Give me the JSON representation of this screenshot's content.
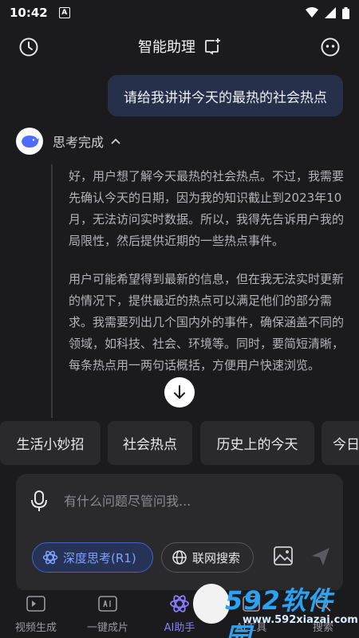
{
  "status": {
    "time": "10:42",
    "notif": "A"
  },
  "header": {
    "title": "智能助理"
  },
  "user_message": "请给我讲讲今天的最热的社会热点",
  "thinking": {
    "label": "思考完成",
    "paragraphs": [
      "好，用户想了解今天最热的社会热点。不过，我需要先确认今天的日期，因为我的知识截止到2023年10月，无法访问实时数据。所以，我得先告诉用户我的局限性，然后提供近期的一些热点事件。",
      "用户可能希望得到最新的信息，但在我无法实时更新的情况下，提供最近的热点可以满足他们的部分需求。我需要列出几个国内外的事件，确保涵盖不同的领域，如科技、社会、环境等。同时，要简短清晰，每条热点用一两句话概括，方便用户快速浏览。"
    ]
  },
  "chips": [
    "生活小妙招",
    "社会热点",
    "历史上的今天",
    "今日"
  ],
  "composer": {
    "placeholder": "有什么问题尽管问我...",
    "deep_think_label": "深度思考(R1)",
    "web_search_label": "联网搜索"
  },
  "tabs": [
    {
      "label": "视频生成",
      "icon": "video-ai-icon"
    },
    {
      "label": "一键成片",
      "icon": "ai-clip-icon"
    },
    {
      "label": "AI助手",
      "icon": "ai-assistant-icon",
      "active": true
    },
    {
      "label": "AI工具",
      "icon": "ai-tool-icon"
    },
    {
      "label": "搜索",
      "icon": "search-icon"
    }
  ],
  "watermark": {
    "brand": "592软件园",
    "url": "www.592xiazai.com"
  },
  "colors": {
    "accent": "#8a7cff",
    "link_blue": "#7da0ff",
    "user_bubble": "#27304a"
  }
}
